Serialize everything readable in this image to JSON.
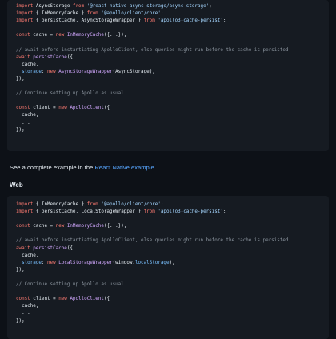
{
  "block1": {
    "lines": [
      [
        [
          "k",
          "import"
        ],
        [
          "t",
          " AsyncStorage "
        ],
        [
          "k",
          "from"
        ],
        [
          "t",
          " "
        ],
        [
          "s",
          "'@react-native-async-storage/async-storage'"
        ],
        [
          "t",
          ";"
        ]
      ],
      [
        [
          "k",
          "import"
        ],
        [
          "t",
          " { InMemoryCache } "
        ],
        [
          "k",
          "from"
        ],
        [
          "t",
          " "
        ],
        [
          "s",
          "'@apollo/client/core'"
        ],
        [
          "t",
          ";"
        ]
      ],
      [
        [
          "k",
          "import"
        ],
        [
          "t",
          " { persistCache, AsyncStorageWrapper } "
        ],
        [
          "k",
          "from"
        ],
        [
          "t",
          " "
        ],
        [
          "s",
          "'apollo3-cache-persist'"
        ],
        [
          "t",
          ";"
        ]
      ],
      [],
      [
        [
          "k",
          "const"
        ],
        [
          "t",
          " cache = "
        ],
        [
          "k",
          "new"
        ],
        [
          "t",
          " "
        ],
        [
          "f",
          "InMemoryCache"
        ],
        [
          "t",
          "({...});"
        ]
      ],
      [],
      [
        [
          "c",
          "// await before instantiating ApolloClient, else queries might run before the cache is persisted"
        ]
      ],
      [
        [
          "k",
          "await"
        ],
        [
          "t",
          " "
        ],
        [
          "f",
          "persistCache"
        ],
        [
          "t",
          "({"
        ]
      ],
      [
        [
          "t",
          "  cache,"
        ]
      ],
      [
        [
          "t",
          "  "
        ],
        [
          "v",
          "storage"
        ],
        [
          "t",
          ": "
        ],
        [
          "k",
          "new"
        ],
        [
          "t",
          " "
        ],
        [
          "f",
          "AsyncStorageWrapper"
        ],
        [
          "t",
          "(AsyncStorage),"
        ]
      ],
      [
        [
          "t",
          "});"
        ]
      ],
      [],
      [
        [
          "c",
          "// Continue setting up Apollo as usual."
        ]
      ],
      [],
      [
        [
          "k",
          "const"
        ],
        [
          "t",
          " client = "
        ],
        [
          "k",
          "new"
        ],
        [
          "t",
          " "
        ],
        [
          "f",
          "ApolloClient"
        ],
        [
          "t",
          "({"
        ]
      ],
      [
        [
          "t",
          "  cache,"
        ]
      ],
      [
        [
          "t",
          "  ..."
        ]
      ],
      [
        [
          "t",
          "});"
        ]
      ]
    ]
  },
  "prose": {
    "before": "See a complete example in the ",
    "link": "React Native example",
    "after": "."
  },
  "heading": "Web",
  "block2": {
    "lines": [
      [
        [
          "k",
          "import"
        ],
        [
          "t",
          " { InMemoryCache } "
        ],
        [
          "k",
          "from"
        ],
        [
          "t",
          " "
        ],
        [
          "s",
          "'@apollo/client/core'"
        ],
        [
          "t",
          ";"
        ]
      ],
      [
        [
          "k",
          "import"
        ],
        [
          "t",
          " { persistCache, LocalStorageWrapper } "
        ],
        [
          "k",
          "from"
        ],
        [
          "t",
          " "
        ],
        [
          "s",
          "'apollo3-cache-persist'"
        ],
        [
          "t",
          ";"
        ]
      ],
      [],
      [
        [
          "k",
          "const"
        ],
        [
          "t",
          " cache = "
        ],
        [
          "k",
          "new"
        ],
        [
          "t",
          " "
        ],
        [
          "f",
          "InMemoryCache"
        ],
        [
          "t",
          "({...});"
        ]
      ],
      [],
      [
        [
          "c",
          "// await before instantiating ApolloClient, else queries might run before the cache is persisted"
        ]
      ],
      [
        [
          "k",
          "await"
        ],
        [
          "t",
          " "
        ],
        [
          "f",
          "persistCache"
        ],
        [
          "t",
          "({"
        ]
      ],
      [
        [
          "t",
          "  cache,"
        ]
      ],
      [
        [
          "t",
          "  "
        ],
        [
          "v",
          "storage"
        ],
        [
          "t",
          ": "
        ],
        [
          "k",
          "new"
        ],
        [
          "t",
          " "
        ],
        [
          "f",
          "LocalStorageWrapper"
        ],
        [
          "t",
          "(window."
        ],
        [
          "v",
          "localStorage"
        ],
        [
          "t",
          "),"
        ]
      ],
      [
        [
          "t",
          "});"
        ]
      ],
      [],
      [
        [
          "c",
          "// Continue setting up Apollo as usual."
        ]
      ],
      [],
      [
        [
          "k",
          "const"
        ],
        [
          "t",
          " client = "
        ],
        [
          "k",
          "new"
        ],
        [
          "t",
          " "
        ],
        [
          "f",
          "ApolloClient"
        ],
        [
          "t",
          "({"
        ]
      ],
      [
        [
          "t",
          "  cache,"
        ]
      ],
      [
        [
          "t",
          "  ..."
        ]
      ],
      [
        [
          "t",
          "});"
        ]
      ]
    ]
  },
  "colors": {
    "background": "#0d1117",
    "code_background": "#161b22",
    "keyword": "#ff7b72",
    "string": "#a5d6ff",
    "function": "#d2a8ff",
    "property": "#79c0ff",
    "comment": "#8b949e",
    "link": "#58a6ff"
  }
}
